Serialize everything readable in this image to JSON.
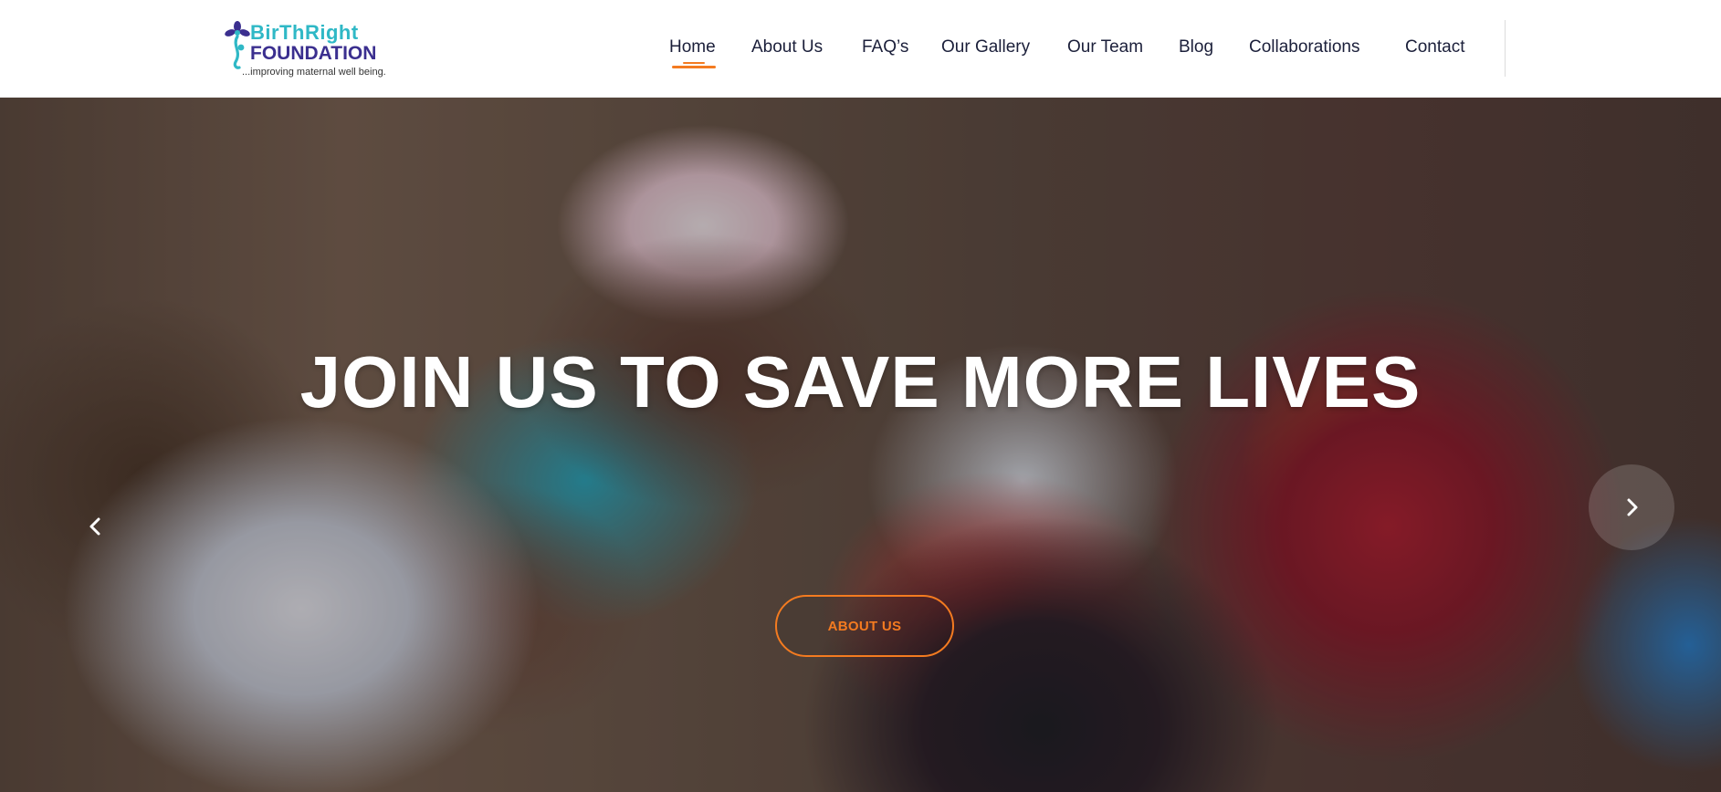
{
  "brand": {
    "name_line1": "BirThRight",
    "name_line2": "FOUNDATION",
    "tagline": "...improving maternal well being."
  },
  "nav": {
    "items": [
      {
        "label": "Home",
        "active": true
      },
      {
        "label": "About Us"
      },
      {
        "label": "FAQ’s"
      },
      {
        "label": "Our Gallery"
      },
      {
        "label": "Our Team"
      },
      {
        "label": "Blog"
      },
      {
        "label": "Collaborations"
      },
      {
        "label": "Contact"
      }
    ]
  },
  "hero": {
    "title": "JOIN US TO SAVE MORE LIVES",
    "button_label": "ABOUT US",
    "prev_icon": "chevron-left-icon",
    "next_icon": "chevron-right-icon"
  },
  "colors": {
    "accent": "#f47b20",
    "brand_teal": "#2fb8c6",
    "brand_purple": "#3b2f8f",
    "nav_text": "#1b1f3a"
  }
}
